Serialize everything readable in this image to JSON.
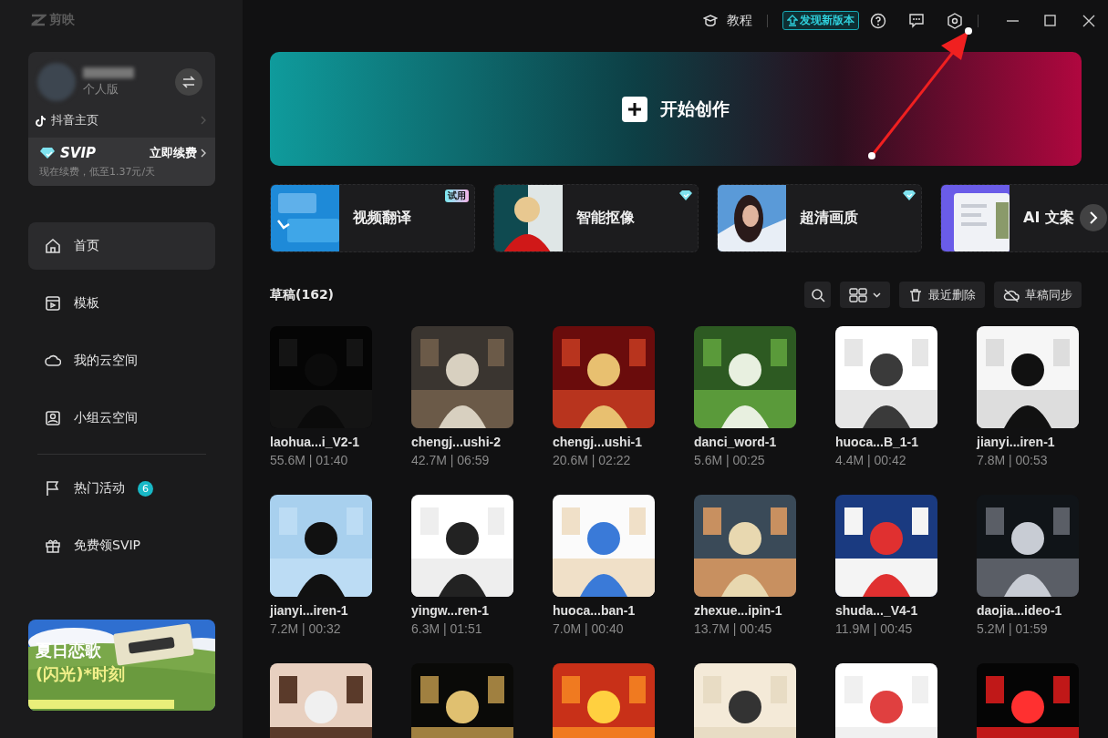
{
  "app": {
    "name": "剪映"
  },
  "titlebar": {
    "tutorial": "教程",
    "update": "发现新版本"
  },
  "account": {
    "edition": "个人版",
    "douyin": "抖音主页",
    "vip": "SVIP",
    "renew": "立即续费",
    "renew_note": "现在续费，低至1.37元/天"
  },
  "nav": [
    {
      "label": "首页",
      "selected": true
    },
    {
      "label": "模板",
      "selected": false
    },
    {
      "label": "我的云空间",
      "selected": false
    },
    {
      "label": "小组云空间",
      "selected": false
    },
    {
      "label": "热门活动",
      "selected": false,
      "badge": "6"
    },
    {
      "label": "免费领SVIP",
      "selected": false
    }
  ],
  "promo": {
    "line_1": "夏日恋歌",
    "line_2": "(闪光)*时刻"
  },
  "create": {
    "label": "开始创作"
  },
  "features": [
    {
      "label": "视频翻译",
      "tag": "试用",
      "premium": false
    },
    {
      "label": "智能抠像",
      "premium": true
    },
    {
      "label": "超清画质",
      "premium": true
    },
    {
      "label": "AI 文案",
      "premium": false
    }
  ],
  "drafts": {
    "title": "草稿(162)",
    "recycle": "最近删除",
    "sync": "草稿同步",
    "items": [
      {
        "kind": "draft",
        "name": "laohua...i_V2-1",
        "meta": "55.6M | 01:40"
      },
      {
        "kind": "draft",
        "name": "chengj...ushi-2",
        "meta": "42.7M | 06:59"
      },
      {
        "kind": "draft",
        "name": "chengj...ushi-1",
        "meta": "20.6M | 02:22"
      },
      {
        "kind": "draft",
        "name": "danci_word-1",
        "meta": "5.6M | 00:25"
      },
      {
        "kind": "draft",
        "name": "huoca...B_1-1",
        "meta": "4.4M | 00:42"
      },
      {
        "kind": "draft",
        "name": "jianyi...iren-1",
        "meta": "7.8M | 00:53"
      },
      {
        "kind": "draft",
        "name": "jianyi...iren-1",
        "meta": "7.2M | 00:32"
      },
      {
        "kind": "draft",
        "name": "yingw...ren-1",
        "meta": "6.3M | 01:51"
      },
      {
        "kind": "draft",
        "name": "huoca...ban-1",
        "meta": "7.0M | 00:40"
      },
      {
        "kind": "draft",
        "name": "zhexue...ipin-1",
        "meta": "13.7M | 00:45"
      },
      {
        "kind": "draft",
        "name": "shuda..._V4-1",
        "meta": "11.9M | 00:45"
      },
      {
        "kind": "draft",
        "name": "daojia...ideo-1",
        "meta": "5.2M | 01:59"
      },
      {
        "kind": "picture"
      },
      {
        "kind": "picture"
      },
      {
        "kind": "picture"
      },
      {
        "kind": "picture"
      },
      {
        "kind": "picture"
      },
      {
        "kind": "picture"
      }
    ]
  }
}
